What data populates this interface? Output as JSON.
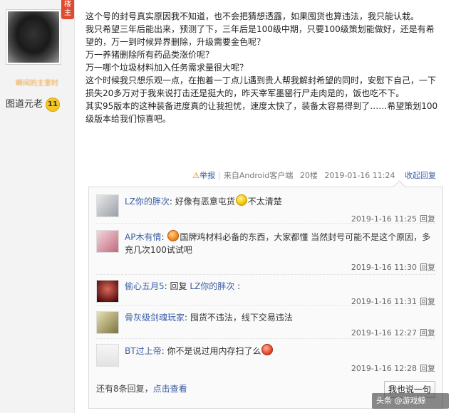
{
  "user": {
    "badge": "楼主",
    "username": "瞬间的主室时",
    "level_label": "图道元老",
    "level_num": "11"
  },
  "post": {
    "lines": [
      "这个号的封号真实原因我不知道，也不会把猜想透露，如果囤货也算违法，我只能认栽。",
      "我只希望三年后能出来，预测了下，三年后是100级中期，只要100级策划能做好，还是有希望的，万一到时候异界删除，升级需要金色呢？",
      "万一养猪删除所有药品类涨价呢？",
      "万一哪个垃圾材料加入任务需求量很大呢？",
      "这个时候我只想乐观一点，在抱着一丁点儿遇到贵人帮我解封希望的同时，安慰下自己，一下损失20多万对于我来说打击还是挺大的，昨天宰军墨罂行尸走肉是的，饭也吃不下。",
      "其实95版本的这种装备进度真的让我担忧，速度太快了，装备太容易得到了……希望策划100级版本给我们惊喜吧。"
    ]
  },
  "meta": {
    "report": "举报",
    "source": "来自Android客户端",
    "floor": "20楼",
    "datetime": "2019-01-16 11:24",
    "collapse": "收起回复"
  },
  "replies": [
    {
      "name": "LZ你的胖次",
      "sep": ":",
      "before": " 好像有恶意屯货",
      "after": "不太清楚",
      "time": "2019-1-16 11:25",
      "reply": "回复",
      "emoji": "yellow"
    },
    {
      "name": "AP木有情",
      "sep": ":",
      "before": " ",
      "after": "国牌鸡材料必备的东西，大家都懂 当然封号可能不是这个原因，多充几次100试试吧",
      "time": "2019-1-16 11:30",
      "reply": "回复",
      "emoji": "orange"
    },
    {
      "name": "偷心五月5",
      "sep": ":",
      "before": " 回复 ",
      "link": "LZ你的胖次",
      "after": " :",
      "time": "2019-1-16 11:31",
      "reply": "回复"
    },
    {
      "name": "骨灰级剑魂玩家",
      "sep": ":",
      "before": " 囤货不违法，线下交易违法",
      "time": "2019-1-16 12:27",
      "reply": "回复"
    },
    {
      "name": "BT过上帝",
      "sep": ":",
      "before": " 你不是说过用内存扫了么",
      "time": "2019-1-16 12:28",
      "reply": "回复",
      "emoji": "red"
    }
  ],
  "footer": {
    "more_prefix": "还有8条回复，",
    "more_link": "点击查看",
    "say_button": "我也说一句"
  },
  "watermark": "头条 @游戏鲸"
}
